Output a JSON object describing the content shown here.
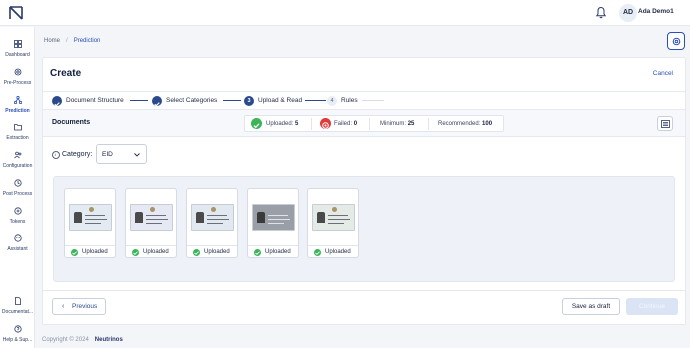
{
  "user": {
    "initials": "AD",
    "name": "Ada Demo1"
  },
  "sidebar": {
    "items": [
      {
        "label": "Dashboard",
        "icon": "grid-icon"
      },
      {
        "label": "Pre-Process",
        "icon": "gear-icon"
      },
      {
        "label": "Prediction",
        "icon": "network-icon",
        "active": true
      },
      {
        "label": "Extraction",
        "icon": "folder-icon"
      },
      {
        "label": "Configuration",
        "icon": "users-icon"
      },
      {
        "label": "Post Process",
        "icon": "clock-icon"
      },
      {
        "label": "Tokens",
        "icon": "token-icon"
      },
      {
        "label": "Assistant",
        "icon": "assistant-icon"
      },
      {
        "label": "Documentat...",
        "icon": "document-icon"
      },
      {
        "label": "Help & Sup...",
        "icon": "help-icon"
      }
    ]
  },
  "breadcrumb": {
    "home": "Home",
    "separator": "/",
    "current": "Prediction"
  },
  "page": {
    "title": "Create",
    "cancel": "Cancel"
  },
  "steps": [
    {
      "label": "Document Structure",
      "state": "done"
    },
    {
      "label": "Select Categories",
      "state": "done"
    },
    {
      "number": "3",
      "label": "Upload & Read",
      "state": "current"
    },
    {
      "number": "4",
      "label": "Rules",
      "state": "todo"
    }
  ],
  "documents": {
    "title": "Documents",
    "uploaded_label": "Uploaded:",
    "uploaded_value": "5",
    "failed_label": "Failed:",
    "failed_value": "0",
    "minimum_label": "Minimum:",
    "minimum_value": "25",
    "recommended_label": "Recommended:",
    "recommended_value": "100"
  },
  "category": {
    "label": "Category:",
    "value": "EID"
  },
  "files": [
    {
      "status": "Uploaded"
    },
    {
      "status": "Uploaded"
    },
    {
      "status": "Uploaded"
    },
    {
      "status": "Uploaded"
    },
    {
      "status": "Uploaded"
    }
  ],
  "actions": {
    "previous": "Previous",
    "draft": "Save as draft",
    "continue": "Continue"
  },
  "footer": {
    "copyright": "Copyright © 2024",
    "brand": "Neutrinos"
  },
  "colors": {
    "accent": "#2a4a8c",
    "link": "#2a4fb8",
    "success": "#3cb55a",
    "danger": "#e03a3a"
  }
}
